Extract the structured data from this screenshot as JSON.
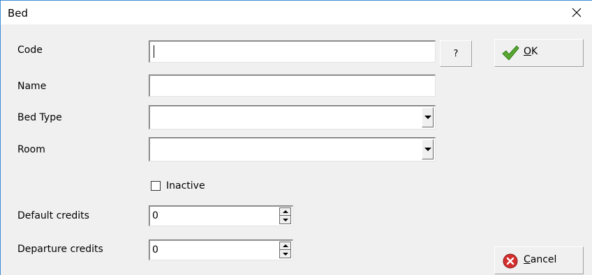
{
  "window": {
    "title": "Bed",
    "accent_color": "#3c8dd6"
  },
  "fields": {
    "code": {
      "label": "Code",
      "value": "",
      "lookup_label": "?"
    },
    "name": {
      "label": "Name",
      "value": ""
    },
    "bed_type": {
      "label": "Bed Type",
      "value": ""
    },
    "room": {
      "label": "Room",
      "value": ""
    },
    "inactive": {
      "label": "Inactive",
      "checked": false
    },
    "default_credits": {
      "label": "Default credits",
      "value": "0"
    },
    "departure_credits": {
      "label": "Departure credits",
      "value": "0"
    }
  },
  "buttons": {
    "ok": {
      "mnemonic": "O",
      "rest": "K",
      "icon": "checkmark-icon"
    },
    "cancel": {
      "mnemonic": "C",
      "rest": "ancel",
      "icon": "cancel-x-icon"
    }
  }
}
